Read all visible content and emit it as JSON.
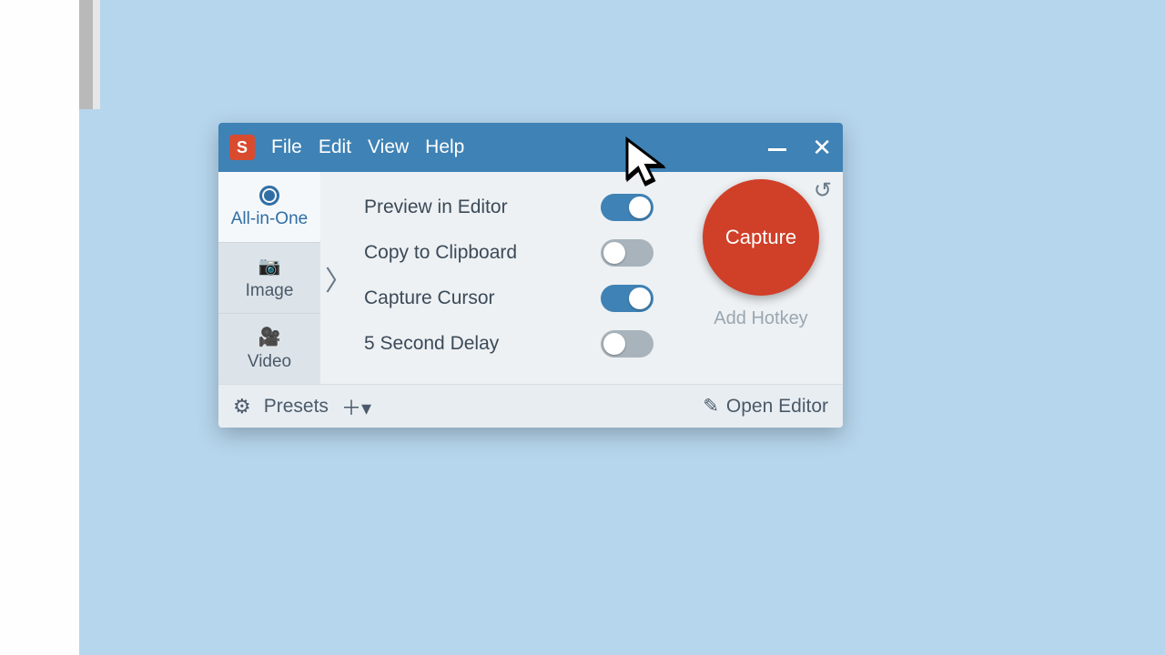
{
  "app": {
    "logo_letter": "S"
  },
  "menu": {
    "file": "File",
    "edit": "Edit",
    "view": "View",
    "help": "Help"
  },
  "tabs": {
    "allinone": "All-in-One",
    "image": "Image",
    "video": "Video"
  },
  "options": {
    "preview_label": "Preview in Editor",
    "preview_on": true,
    "clipboard_label": "Copy to Clipboard",
    "clipboard_on": false,
    "cursor_label": "Capture Cursor",
    "cursor_on": true,
    "delay_label": "5 Second Delay",
    "delay_on": false
  },
  "capture": {
    "button": "Capture",
    "hotkey": "Add Hotkey"
  },
  "footer": {
    "presets": "Presets",
    "open_editor": "Open Editor"
  }
}
